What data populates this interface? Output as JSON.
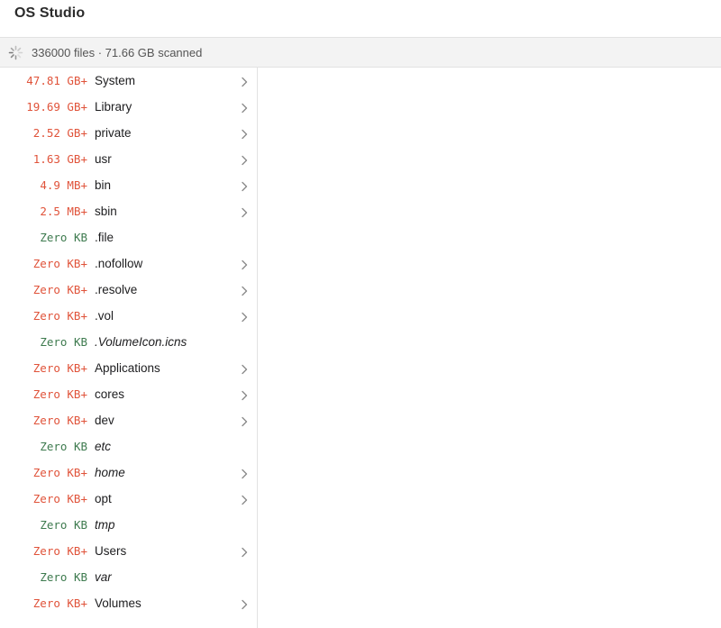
{
  "app": {
    "title": "OS Studio"
  },
  "status": {
    "text": "336000 files · 71.66 GB scanned"
  },
  "colors": {
    "size_red": "#e0533a",
    "size_green": "#3d7a4e",
    "chevron": "#8a8a8a"
  },
  "tree": {
    "items": [
      {
        "size": "47.81 GB+",
        "name": "System",
        "size_color": "red",
        "italic": false,
        "expandable": true
      },
      {
        "size": "19.69 GB+",
        "name": "Library",
        "size_color": "red",
        "italic": false,
        "expandable": true
      },
      {
        "size": "2.52 GB+",
        "name": "private",
        "size_color": "red",
        "italic": false,
        "expandable": true
      },
      {
        "size": "1.63 GB+",
        "name": "usr",
        "size_color": "red",
        "italic": false,
        "expandable": true
      },
      {
        "size": "4.9 MB+",
        "name": "bin",
        "size_color": "red",
        "italic": false,
        "expandable": true
      },
      {
        "size": "2.5 MB+",
        "name": "sbin",
        "size_color": "red",
        "italic": false,
        "expandable": true
      },
      {
        "size": "Zero KB",
        "name": ".file",
        "size_color": "green",
        "italic": false,
        "expandable": false
      },
      {
        "size": "Zero KB+",
        "name": ".nofollow",
        "size_color": "red",
        "italic": false,
        "expandable": true
      },
      {
        "size": "Zero KB+",
        "name": ".resolve",
        "size_color": "red",
        "italic": false,
        "expandable": true
      },
      {
        "size": "Zero KB+",
        "name": ".vol",
        "size_color": "red",
        "italic": false,
        "expandable": true
      },
      {
        "size": "Zero KB",
        "name": ".VolumeIcon.icns",
        "size_color": "green",
        "italic": true,
        "expandable": false
      },
      {
        "size": "Zero KB+",
        "name": "Applications",
        "size_color": "red",
        "italic": false,
        "expandable": true
      },
      {
        "size": "Zero KB+",
        "name": "cores",
        "size_color": "red",
        "italic": false,
        "expandable": true
      },
      {
        "size": "Zero KB+",
        "name": "dev",
        "size_color": "red",
        "italic": false,
        "expandable": true
      },
      {
        "size": "Zero KB",
        "name": "etc",
        "size_color": "green",
        "italic": true,
        "expandable": false
      },
      {
        "size": "Zero KB+",
        "name": "home",
        "size_color": "red",
        "italic": true,
        "expandable": true
      },
      {
        "size": "Zero KB+",
        "name": "opt",
        "size_color": "red",
        "italic": false,
        "expandable": true
      },
      {
        "size": "Zero KB",
        "name": "tmp",
        "size_color": "green",
        "italic": true,
        "expandable": false
      },
      {
        "size": "Zero KB+",
        "name": "Users",
        "size_color": "red",
        "italic": false,
        "expandable": true
      },
      {
        "size": "Zero KB",
        "name": "var",
        "size_color": "green",
        "italic": true,
        "expandable": false
      },
      {
        "size": "Zero KB+",
        "name": "Volumes",
        "size_color": "red",
        "italic": false,
        "expandable": true
      }
    ]
  }
}
